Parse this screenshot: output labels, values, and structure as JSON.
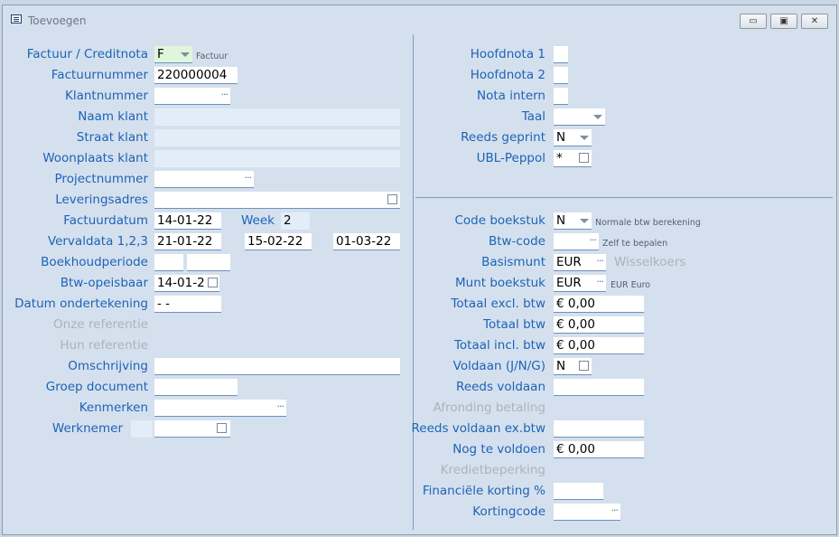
{
  "window": {
    "title": "Toevoegen",
    "minimize": "▭",
    "maximize": "▣",
    "close": "✕"
  },
  "left": {
    "factuur_creditnota": {
      "label": "Factuur / Creditnota",
      "value": "F",
      "hint": "Factuur"
    },
    "factuurnummer": {
      "label": "Factuurnummer",
      "value": "220000004"
    },
    "klantnummer": {
      "label": "Klantnummer",
      "value": ""
    },
    "naam_klant": {
      "label": "Naam klant",
      "value": ""
    },
    "straat_klant": {
      "label": "Straat klant",
      "value": ""
    },
    "woonplaats_klant": {
      "label": "Woonplaats klant",
      "value": ""
    },
    "projectnummer": {
      "label": "Projectnummer",
      "value": ""
    },
    "leveringsadres": {
      "label": "Leveringsadres",
      "value": ""
    },
    "factuurdatum": {
      "label": "Factuurdatum",
      "value": "14-01-22",
      "week_label": "Week",
      "week_value": "2"
    },
    "vervaldata": {
      "label": "Vervaldata 1,2,3",
      "value1": "21-01-22",
      "value2": "15-02-22",
      "value3": "01-03-22"
    },
    "boekhoudperiode": {
      "label": "Boekhoudperiode",
      "value1": "",
      "value2": ""
    },
    "btw_opeisbaar": {
      "label": "Btw-opeisbaar",
      "value": "14-01-2"
    },
    "datum_ondertekening": {
      "label": "Datum ondertekening",
      "value": "-  -"
    },
    "onze_referentie": {
      "label": "Onze referentie"
    },
    "hun_referentie": {
      "label": "Hun referentie"
    },
    "omschrijving": {
      "label": "Omschrijving",
      "value": ""
    },
    "groep_document": {
      "label": "Groep document",
      "value": ""
    },
    "kenmerken": {
      "label": "Kenmerken",
      "value": ""
    },
    "werknemer": {
      "label": "Werknemer",
      "value": ""
    }
  },
  "right": {
    "hoofdnota1": {
      "label": "Hoofdnota 1",
      "value": ""
    },
    "hoofdnota2": {
      "label": "Hoofdnota 2",
      "value": ""
    },
    "nota_intern": {
      "label": "Nota intern",
      "value": ""
    },
    "taal": {
      "label": "Taal",
      "value": ""
    },
    "reeds_geprint": {
      "label": "Reeds geprint",
      "value": "N"
    },
    "ubl_peppol": {
      "label": "UBL-Peppol",
      "value": "*"
    },
    "code_boekstuk": {
      "label": "Code boekstuk",
      "value": "N",
      "hint": "Normale btw berekening"
    },
    "btw_code": {
      "label": "Btw-code",
      "value": "",
      "hint": "Zelf te bepalen"
    },
    "basismunt": {
      "label": "Basismunt",
      "value": "EUR",
      "hint": "Wisselkoers"
    },
    "munt_boekstuk": {
      "label": "Munt boekstuk",
      "value": "EUR",
      "hint": "EUR Euro"
    },
    "totaal_excl": {
      "label": "Totaal excl. btw",
      "value": "€ 0,00"
    },
    "totaal_btw": {
      "label": "Totaal btw",
      "value": "€ 0,00"
    },
    "totaal_incl": {
      "label": "Totaal incl. btw",
      "value": "€ 0,00"
    },
    "voldaan": {
      "label": "Voldaan (J/N/G)",
      "value": "N"
    },
    "reeds_voldaan": {
      "label": "Reeds voldaan",
      "value": ""
    },
    "afronding_betaling": {
      "label": "Afronding betaling"
    },
    "reeds_voldaan_ex": {
      "label": "Reeds voldaan ex.btw",
      "value": ""
    },
    "nog_te_voldoen": {
      "label": "Nog te voldoen",
      "value": "€ 0,00"
    },
    "kredietbeperking": {
      "label": "Kredietbeperking"
    },
    "financiele_korting": {
      "label": "Financiële korting %",
      "value": ""
    },
    "kortingcode": {
      "label": "Kortingcode",
      "value": ""
    }
  }
}
